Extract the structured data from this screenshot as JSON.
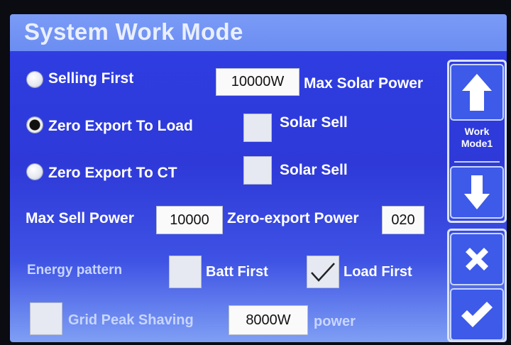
{
  "screen": {
    "title": "System Work Mode"
  },
  "modes": [
    {
      "label": "Selling First",
      "selected": false
    },
    {
      "label": "Zero Export To Load",
      "selected": true
    },
    {
      "label": "Zero Export To CT",
      "selected": false
    }
  ],
  "max_solar_power": {
    "value": "10000W",
    "label": "Max Solar Power"
  },
  "solar_sell_load": {
    "label": "Solar Sell",
    "checked": false
  },
  "solar_sell_ct": {
    "label": "Solar Sell",
    "checked": false
  },
  "max_sell_power": {
    "label": "Max Sell Power",
    "value": "10000"
  },
  "zero_export_power": {
    "label": "Zero-export Power",
    "value": "020"
  },
  "energy_pattern": {
    "label": "Energy pattern",
    "options": [
      {
        "label": "Batt First",
        "checked": false
      },
      {
        "label": "Load First",
        "checked": true
      }
    ]
  },
  "grid_peak_shaving": {
    "label": "Grid Peak Shaving",
    "checked": false,
    "value": "8000W",
    "unit_label": "power"
  },
  "side": {
    "mode_label": "Work\nMode1",
    "icons": [
      "arrow-up-icon",
      "arrow-down-icon",
      "close-icon",
      "checkmark-icon"
    ]
  },
  "colors": {
    "background": "#2e3ad9",
    "title_bar": "#7090f4",
    "field": "#fafafa"
  }
}
